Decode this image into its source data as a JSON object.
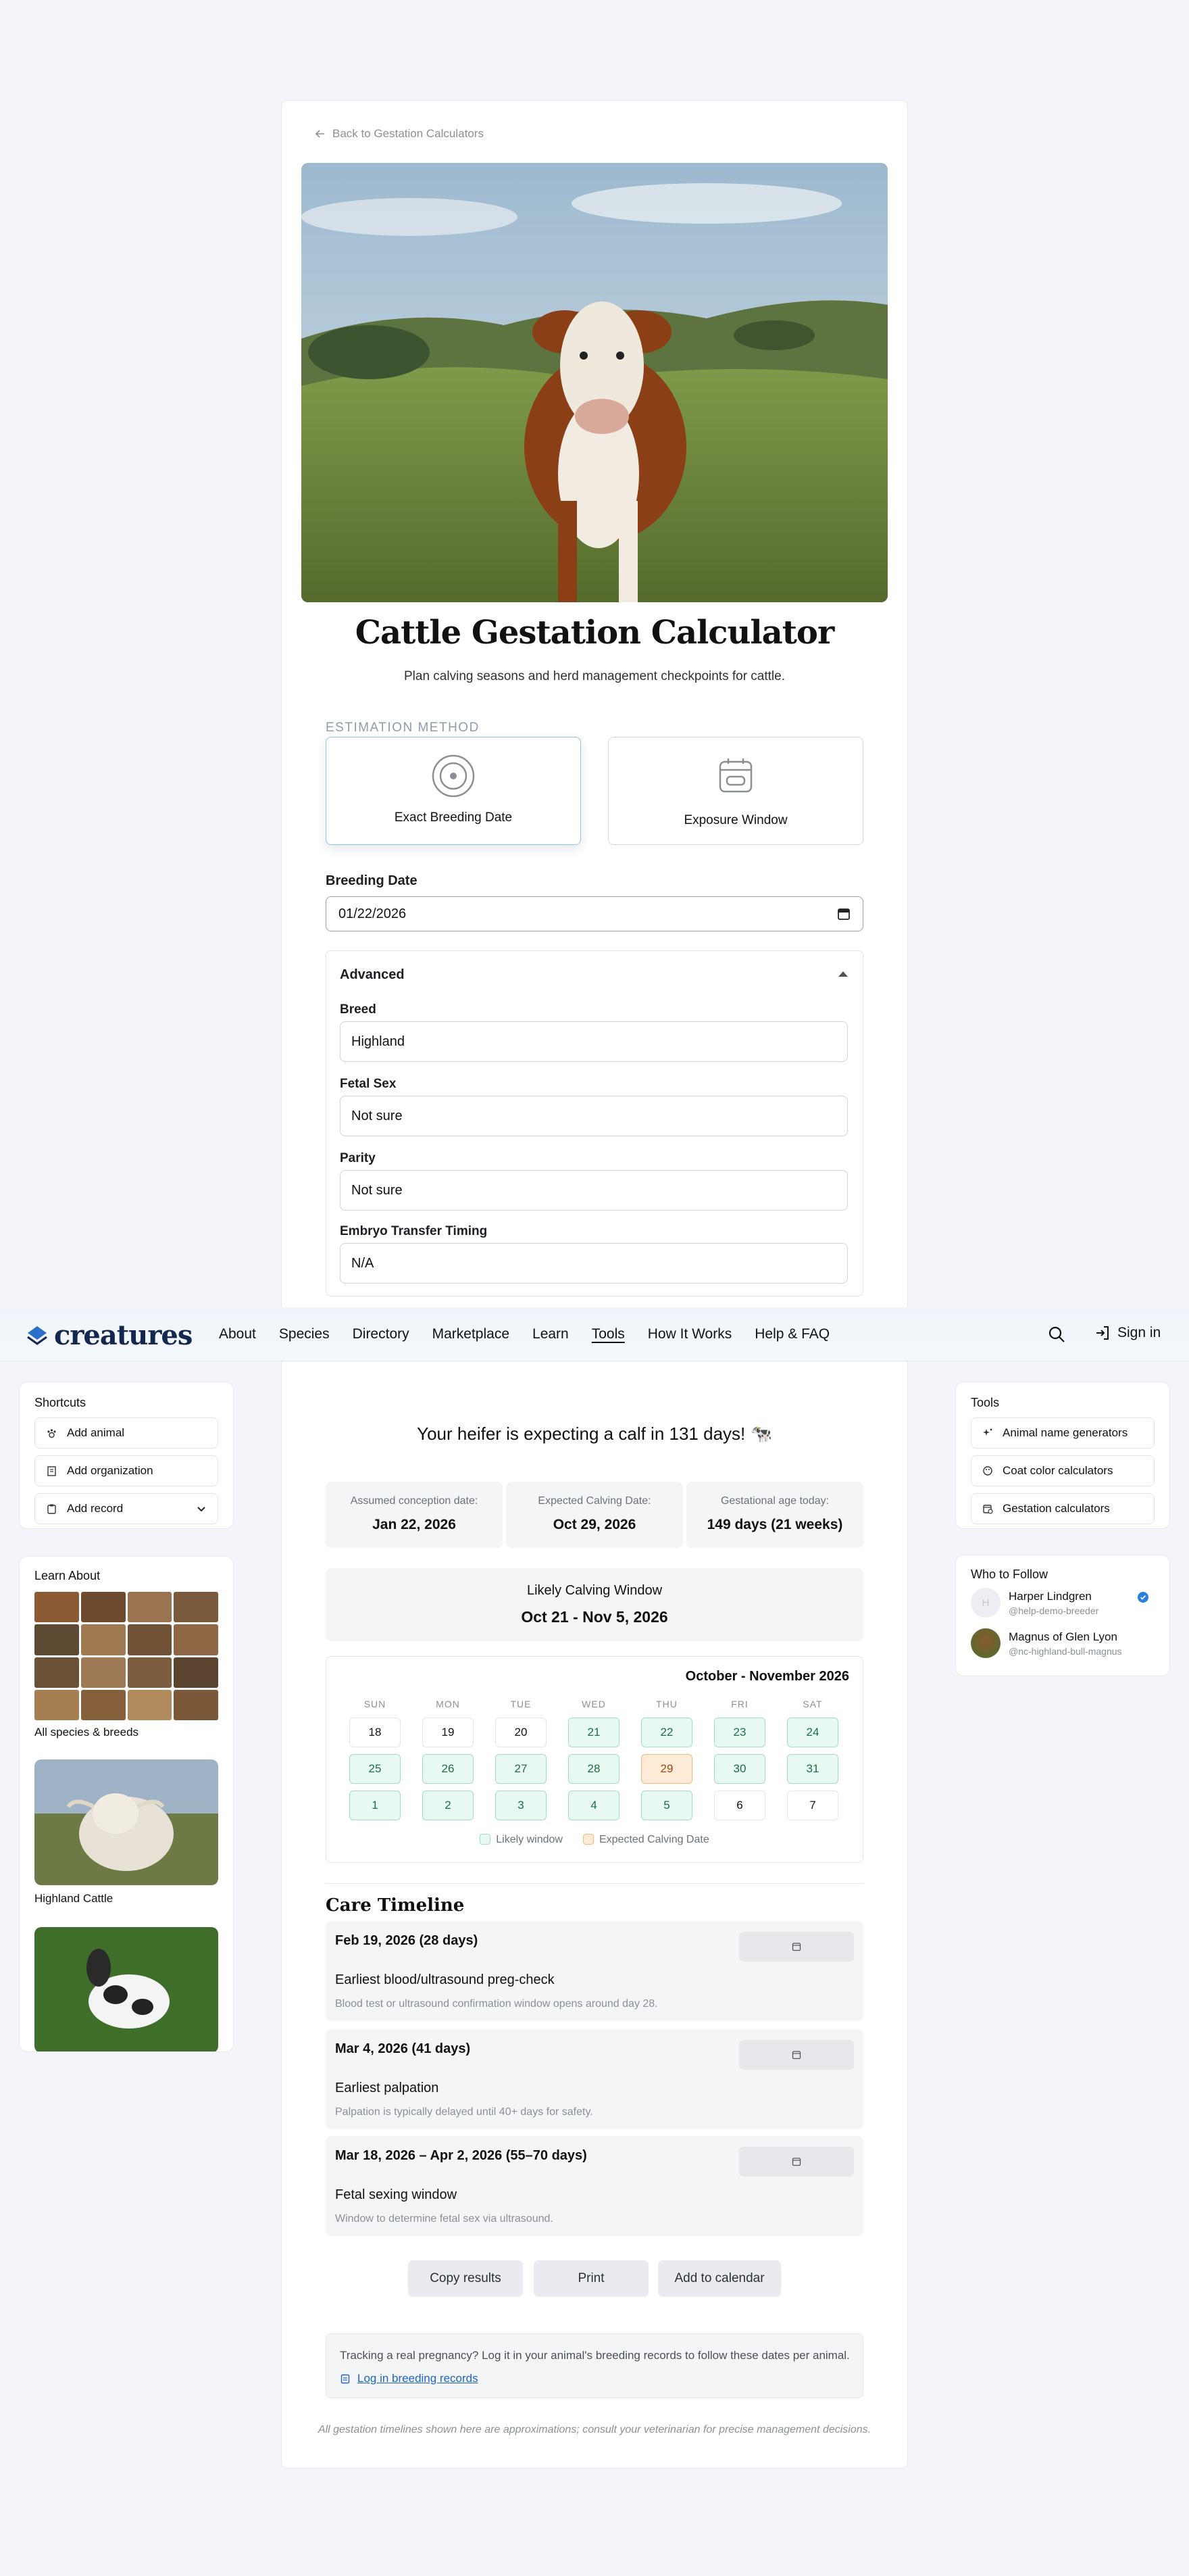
{
  "back_link": "Back to Gestation Calculators",
  "title": "Cattle Gestation Calculator",
  "subtitle": "Plan calving seasons and herd management checkpoints for cattle.",
  "estimation": {
    "label": "ESTIMATION METHOD",
    "options": [
      {
        "label": "Exact Breeding Date",
        "icon": "target-icon",
        "selected": true
      },
      {
        "label": "Exposure Window",
        "icon": "calendar-window-icon",
        "selected": false
      }
    ]
  },
  "breeding_date": {
    "label": "Breeding Date",
    "value": "01/22/2026"
  },
  "advanced": {
    "title": "Advanced",
    "fields": [
      {
        "label": "Breed",
        "value": "Highland"
      },
      {
        "label": "Fetal Sex",
        "value": "Not sure"
      },
      {
        "label": "Parity",
        "value": "Not sure"
      },
      {
        "label": "Embryo Transfer Timing",
        "value": "N/A"
      }
    ]
  },
  "nav": {
    "logo": "creatures",
    "links": [
      "About",
      "Species",
      "Directory",
      "Marketplace",
      "Learn",
      "Tools",
      "How It Works",
      "Help & FAQ"
    ],
    "active": "Tools",
    "signin": "Sign in"
  },
  "shortcuts": {
    "title": "Shortcuts",
    "items": [
      "Add animal",
      "Add organization",
      "Add record"
    ]
  },
  "learn": {
    "title": "Learn About",
    "all_species": "All species & breeds",
    "highland": "Highland Cattle"
  },
  "tools": {
    "title": "Tools",
    "items": [
      "Animal name generators",
      "Coat color calculators",
      "Gestation calculators"
    ]
  },
  "follow": {
    "title": "Who to Follow",
    "people": [
      {
        "name": "Harper Lindgren",
        "handle": "@help-demo-breeder",
        "initial": "H",
        "verified": true
      },
      {
        "name": "Magnus of Glen Lyon",
        "handle": "@nc-highland-bull-magnus",
        "verified": false
      }
    ]
  },
  "results": {
    "expecting": "Your heifer is expecting a calf in 131 days! 🐄",
    "stats": [
      {
        "label": "Assumed conception date:",
        "value": "Jan 22, 2026"
      },
      {
        "label": "Expected Calving Date:",
        "value": "Oct 29, 2026"
      },
      {
        "label": "Gestational age today:",
        "value": "149 days (21 weeks)"
      }
    ],
    "window_label": "Likely Calving Window",
    "window_value": "Oct 21 - Nov 5, 2026"
  },
  "calendar": {
    "month": "October - November 2026",
    "dow": [
      "SUN",
      "MON",
      "TUE",
      "WED",
      "THU",
      "FRI",
      "SAT"
    ],
    "weeks": [
      [
        {
          "d": "18",
          "s": ""
        },
        {
          "d": "19",
          "s": ""
        },
        {
          "d": "20",
          "s": ""
        },
        {
          "d": "21",
          "s": "likely"
        },
        {
          "d": "22",
          "s": "likely"
        },
        {
          "d": "23",
          "s": "likely"
        },
        {
          "d": "24",
          "s": "likely"
        }
      ],
      [
        {
          "d": "25",
          "s": "likely"
        },
        {
          "d": "26",
          "s": "likely"
        },
        {
          "d": "27",
          "s": "likely"
        },
        {
          "d": "28",
          "s": "likely"
        },
        {
          "d": "29",
          "s": "expected"
        },
        {
          "d": "30",
          "s": "likely"
        },
        {
          "d": "31",
          "s": "likely"
        }
      ],
      [
        {
          "d": "1",
          "s": "likely"
        },
        {
          "d": "2",
          "s": "likely"
        },
        {
          "d": "3",
          "s": "likely"
        },
        {
          "d": "4",
          "s": "likely"
        },
        {
          "d": "5",
          "s": "likely"
        },
        {
          "d": "6",
          "s": ""
        },
        {
          "d": "7",
          "s": ""
        }
      ]
    ],
    "legend_likely": "Likely window",
    "legend_expected": "Expected Calving Date",
    "colors": {
      "likely": "#e8f9f1",
      "expected": "#fdebd7"
    }
  },
  "timeline": {
    "title": "Care Timeline",
    "items": [
      {
        "date": "Feb 19, 2026 (28 days)",
        "title": "Earliest blood/ultrasound preg-check",
        "desc": "Blood test or ultrasound confirmation window opens around day 28."
      },
      {
        "date": "Mar 4, 2026 (41 days)",
        "title": "Earliest palpation",
        "desc": "Palpation is typically delayed until 40+ days for safety."
      },
      {
        "date": "Mar 18, 2026 – Apr 2, 2026 (55–70 days)",
        "title": "Fetal sexing window",
        "desc": "Window to determine fetal sex via ultrasound."
      }
    ]
  },
  "actions": [
    "Copy results",
    "Print",
    "Add to calendar"
  ],
  "tracking": {
    "text": "Tracking a real pregnancy? Log it in your animal's breeding records to follow these dates per animal.",
    "link": "Log in breeding records"
  },
  "disclaimer": "All gestation timelines shown here are approximations; consult your veterinarian for precise management decisions."
}
